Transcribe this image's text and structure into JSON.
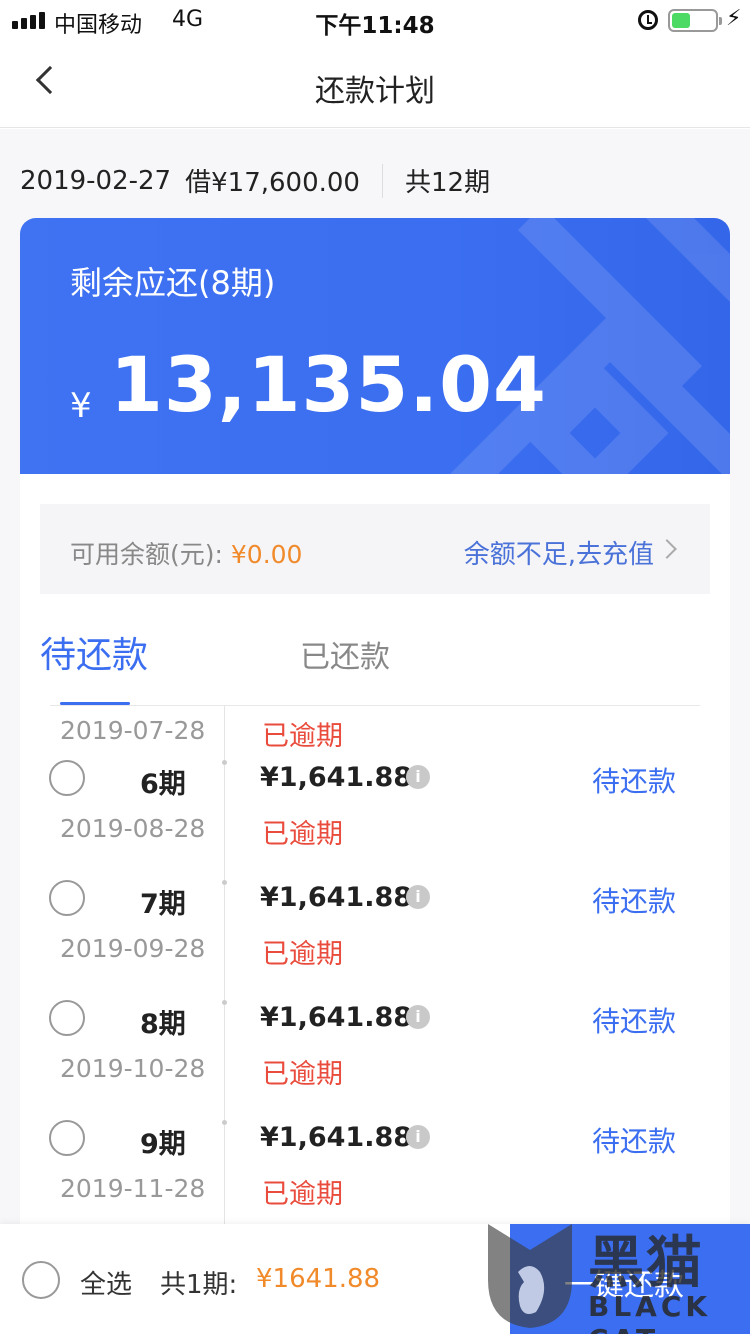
{
  "status_bar": {
    "carrier": "中国移动",
    "network": "4G",
    "time": "下午11:48",
    "charging_glyph": "⚡",
    "battery_level": 0.35,
    "icons": [
      "signal-icon",
      "alarm-icon",
      "battery-icon",
      "charging-icon"
    ]
  },
  "nav": {
    "title": "还款计划",
    "back_icon": "back-chevron-icon"
  },
  "loan": {
    "date": "2019-02-27",
    "borrowed": "借¥17,600.00",
    "periods": "共12期"
  },
  "card": {
    "label": "剩余应还(8期)",
    "currency": "¥",
    "amount": "13,135.04"
  },
  "balance": {
    "label": "可用余额(元): ",
    "value": "¥0.00",
    "link": "余额不足,去充值",
    "chevron_icon": "chevron-right-icon"
  },
  "tabs": [
    {
      "label": "待还款",
      "active": true
    },
    {
      "label": "已还款",
      "active": false
    }
  ],
  "installments": [
    {
      "period": "",
      "amount": "",
      "status": "",
      "date": "2019-07-28",
      "overdue": "已逾期"
    },
    {
      "period": "6期",
      "amount": "¥1,641.88",
      "status": "待还款",
      "date": "2019-08-28",
      "overdue": "已逾期"
    },
    {
      "period": "7期",
      "amount": "¥1,641.88",
      "status": "待还款",
      "date": "2019-09-28",
      "overdue": "已逾期"
    },
    {
      "period": "8期",
      "amount": "¥1,641.88",
      "status": "待还款",
      "date": "2019-10-28",
      "overdue": "已逾期"
    },
    {
      "period": "9期",
      "amount": "¥1,641.88",
      "status": "待还款",
      "date": "2019-11-28",
      "overdue": "已逾期"
    }
  ],
  "info_glyph": "i",
  "bottom": {
    "select_all": "全选",
    "count": "共1期:",
    "sum": "¥1641.88",
    "pay_button": "一键还款"
  },
  "watermark": {
    "cn": "黑猫",
    "en": "BLACK CAT"
  },
  "colors": {
    "accent": "#3b6ef0",
    "overdue": "#e94b3c",
    "money": "#f08a2b"
  }
}
